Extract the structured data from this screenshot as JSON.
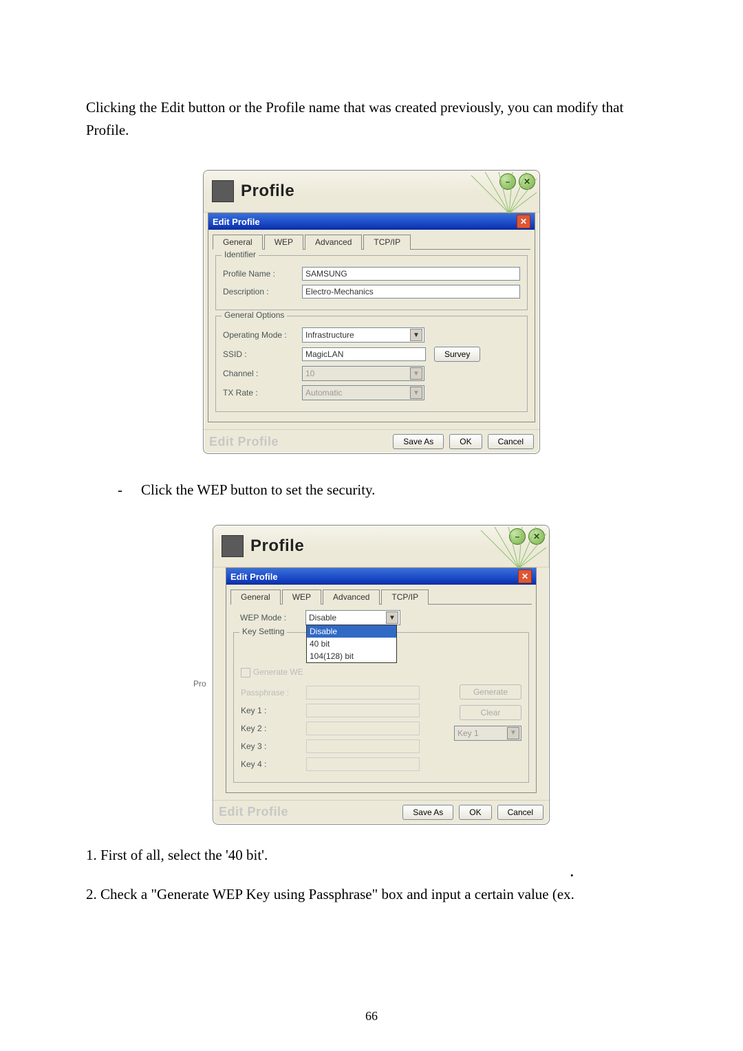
{
  "intro": "Clicking the Edit button or the Profile name that was created previously, you can modify that Profile.",
  "bullet_text": "Click the WEP button to set the security.",
  "num_1": "1. First of all, select the '40 bit'.",
  "num_2": "2. Check a \"Generate WEP Key using Passphrase\" box and input a certain value (ex.",
  "page_number": "66",
  "ss1": {
    "banner_title": "Profile",
    "dlg_title": "Edit Profile",
    "tabs": {
      "general": "General",
      "wep": "WEP",
      "advanced": "Advanced",
      "tcpip": "TCP/IP"
    },
    "identifier_legend": "Identifier",
    "profile_name_label": "Profile Name :",
    "profile_name_value": "SAMSUNG",
    "description_label": "Description :",
    "description_value": "Electro-Mechanics",
    "general_options_legend": "General Options",
    "operating_mode_label": "Operating Mode :",
    "operating_mode_value": "Infrastructure",
    "ssid_label": "SSID :",
    "ssid_value": "MagicLAN",
    "survey_btn": "Survey",
    "channel_label": "Channel :",
    "channel_value": "10",
    "txrate_label": "TX Rate :",
    "txrate_value": "Automatic",
    "footer_brand": "Edit Profile",
    "saveas_btn": "Save As",
    "ok_btn": "OK",
    "cancel_btn": "Cancel"
  },
  "ss2": {
    "banner_title": "Profile",
    "dlg_title": "Edit Profile",
    "tabs": {
      "general": "General",
      "wep": "WEP",
      "advanced": "Advanced",
      "tcpip": "TCP/IP"
    },
    "wep_mode_label": "WEP Mode :",
    "wep_mode_value": "Disable",
    "wep_options": {
      "disable": "Disable",
      "b40": "40 bit",
      "b104": "104(128) bit"
    },
    "key_setting_legend": "Key Setting",
    "generate_label": "Generate WE",
    "passphrase_label": "Passphrase :",
    "key1": "Key 1 :",
    "key2": "Key 2 :",
    "key3": "Key 3 :",
    "key4": "Key 4 :",
    "generate_btn": "Generate",
    "clear_btn": "Clear",
    "key_select": "Key 1",
    "footer_brand": "Edit Profile",
    "saveas_btn": "Save As",
    "ok_btn": "OK",
    "cancel_btn": "Cancel",
    "side_label": "Pro"
  }
}
